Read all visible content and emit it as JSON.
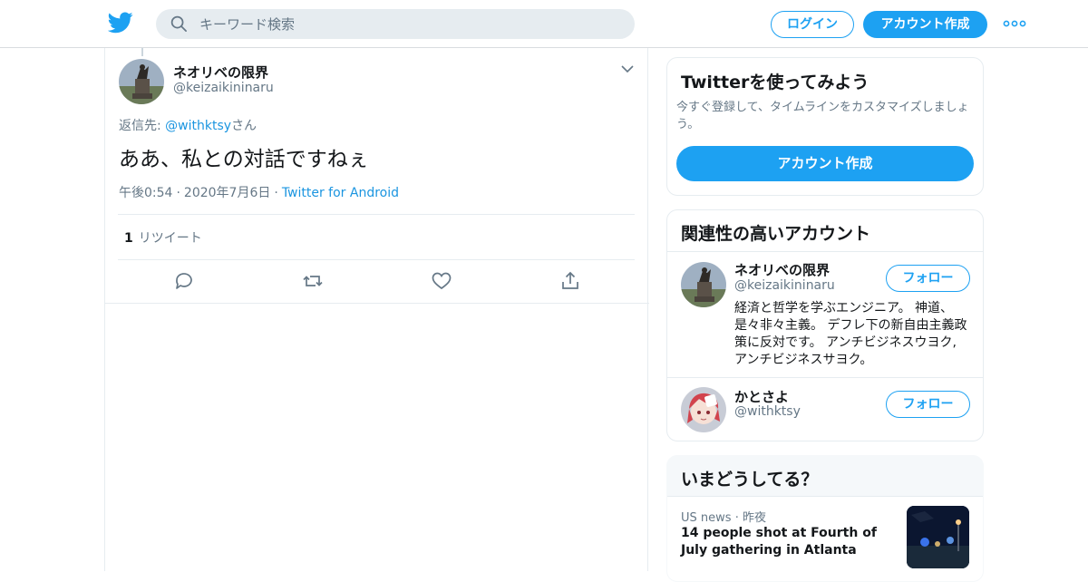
{
  "header": {
    "search_placeholder": "キーワード検索",
    "login_label": "ログイン",
    "signup_label": "アカウント作成",
    "brand_color": "#1da1f2",
    "icons": [
      "twitter-bird-icon",
      "search-icon",
      "more-icon"
    ]
  },
  "tweet": {
    "author_name": "ネオリベの限界",
    "author_handle": "@keizaikininaru",
    "reply_prefix": "返信先: ",
    "reply_to": "@withktsy",
    "reply_suffix": "さん",
    "text": "ああ、私との対話ですねぇ",
    "time": "午後0:54",
    "date": "2020年7月6日",
    "source": "Twitter for Android",
    "dot": "·",
    "retweet_count": "1",
    "retweet_label": "リツイート",
    "action_icons": [
      "reply-icon",
      "retweet-icon",
      "like-icon",
      "share-icon"
    ]
  },
  "signup_card": {
    "title": "Twitterを使ってみよう",
    "description": "今すぐ登録して、タイムラインをカスタマイズしましょう。",
    "button_label": "アカウント作成"
  },
  "related": {
    "title": "関連性の高いアカウント",
    "accounts": [
      {
        "name": "ネオリベの限界",
        "handle": "@keizaikininaru",
        "bio": "経済と哲学を学ぶエンジニア。 神道、是々非々主義。 デフレ下の新自由主義政策に反対です。 アンチビジネスウヨク, アンチビジネスサヨク。",
        "follow_label": "フォロー"
      },
      {
        "name": "かとさよ",
        "handle": "@withktsy",
        "bio": "",
        "follow_label": "フォロー"
      }
    ]
  },
  "trends": {
    "title": "いまどうしてる？",
    "items": [
      {
        "category": "US news",
        "dot": "·",
        "time": "昨夜",
        "headline": "14 people shot at Fourth of July gathering in Atlanta"
      }
    ]
  }
}
